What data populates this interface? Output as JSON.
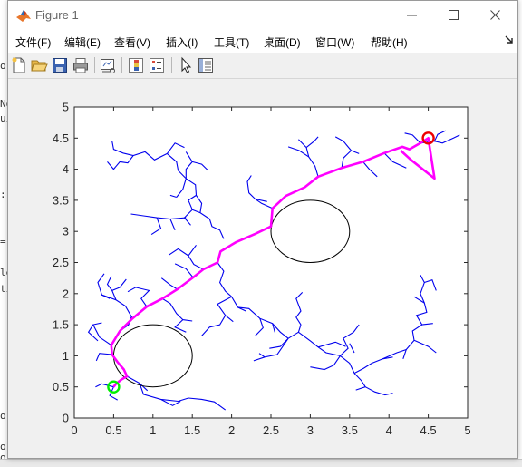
{
  "window": {
    "title": "Figure 1"
  },
  "menu": [
    "文件(F)",
    "编辑(E)",
    "查看(V)",
    "插入(I)",
    "工具(T)",
    "桌面(D)",
    "窗口(W)",
    "帮助(H)"
  ],
  "toolbar": [
    "new-figure",
    "open-file",
    "save-figure",
    "print-figure",
    "link-plot",
    "insert-colorbar",
    "insert-legend",
    "edit-plot",
    "property-inspector"
  ],
  "background_text": [
    "No",
    "ui",
    ":",
    "=",
    "le",
    "ti",
    "o",
    "o:",
    "o(",
    "o)"
  ],
  "chart_data": {
    "type": "line",
    "title": "",
    "xlabel": "",
    "ylabel": "",
    "xlim": [
      0,
      5
    ],
    "ylim": [
      0,
      5
    ],
    "xticks": [
      "0",
      "0.5",
      "1",
      "1.5",
      "2",
      "2.5",
      "3",
      "3.5",
      "4",
      "4.5",
      "5"
    ],
    "yticks": [
      "0",
      "0.5",
      "1",
      "1.5",
      "2",
      "2.5",
      "3",
      "3.5",
      "4",
      "4.5",
      "5"
    ],
    "grid": false,
    "obstacles": [
      {
        "cx": 1.0,
        "cy": 1.0,
        "rx": 0.5,
        "ry": 0.5,
        "color": "#000000"
      },
      {
        "cx": 3.0,
        "cy": 3.0,
        "rx": 0.5,
        "ry": 0.5,
        "color": "#000000"
      }
    ],
    "start": {
      "x": 0.5,
      "y": 0.5,
      "color": "#00ee00"
    },
    "goal": {
      "x": 4.5,
      "y": 4.5,
      "color": "#ee0000"
    },
    "tree_color": "#0000ee",
    "path_color": "#ff00ff",
    "path": [
      [
        0.5,
        0.5
      ],
      [
        0.53,
        0.55
      ],
      [
        0.6,
        0.62
      ],
      [
        0.67,
        0.67
      ],
      [
        0.63,
        0.78
      ],
      [
        0.55,
        0.9
      ],
      [
        0.48,
        1.02
      ],
      [
        0.47,
        1.17
      ],
      [
        0.58,
        1.4
      ],
      [
        0.74,
        1.6
      ],
      [
        0.92,
        1.79
      ],
      [
        1.12,
        1.92
      ],
      [
        1.31,
        2.07
      ],
      [
        1.51,
        2.26
      ],
      [
        1.64,
        2.39
      ],
      [
        1.82,
        2.5
      ],
      [
        1.86,
        2.68
      ],
      [
        2.06,
        2.83
      ],
      [
        2.3,
        2.96
      ],
      [
        2.5,
        3.08
      ],
      [
        2.52,
        3.37
      ],
      [
        2.69,
        3.57
      ],
      [
        2.93,
        3.71
      ],
      [
        3.1,
        3.88
      ],
      [
        3.4,
        4.02
      ],
      [
        3.67,
        4.12
      ],
      [
        3.94,
        4.26
      ],
      [
        4.17,
        4.36
      ],
      [
        4.26,
        4.32
      ],
      [
        4.4,
        4.42
      ],
      [
        4.5,
        4.5
      ],
      [
        4.58,
        3.85
      ],
      [
        4.28,
        4.15
      ],
      [
        4.15,
        4.3
      ]
    ],
    "tree": [
      [
        [
          0.5,
          0.5
        ],
        [
          0.35,
          0.55
        ],
        [
          0.27,
          0.5
        ]
      ],
      [
        [
          0.5,
          0.5
        ],
        [
          0.45,
          0.36
        ],
        [
          0.55,
          0.29
        ]
      ],
      [
        [
          0.67,
          0.67
        ],
        [
          0.83,
          0.56
        ],
        [
          0.88,
          0.38
        ],
        [
          1.1,
          0.3
        ],
        [
          1.32,
          0.27
        ],
        [
          1.45,
          0.32
        ]
      ],
      [
        [
          1.1,
          0.3
        ],
        [
          1.25,
          0.2
        ],
        [
          1.35,
          0.27
        ]
      ],
      [
        [
          1.45,
          0.32
        ],
        [
          1.62,
          0.3
        ],
        [
          1.78,
          0.26
        ],
        [
          1.92,
          0.13
        ]
      ],
      [
        [
          0.83,
          0.56
        ],
        [
          0.93,
          0.44
        ]
      ],
      [
        [
          0.48,
          1.02
        ],
        [
          0.32,
          1.04
        ],
        [
          0.28,
          0.92
        ]
      ],
      [
        [
          0.47,
          1.17
        ],
        [
          0.32,
          1.3
        ],
        [
          0.24,
          1.5
        ],
        [
          0.35,
          1.53
        ]
      ],
      [
        [
          0.24,
          1.5
        ],
        [
          0.18,
          1.38
        ],
        [
          0.3,
          1.24
        ]
      ],
      [
        [
          0.58,
          1.4
        ],
        [
          0.69,
          1.5
        ],
        [
          0.73,
          1.64
        ]
      ],
      [
        [
          0.74,
          1.6
        ],
        [
          0.65,
          1.8
        ],
        [
          0.53,
          1.9
        ],
        [
          0.48,
          2.05
        ],
        [
          0.42,
          2.15
        ],
        [
          0.47,
          2.28
        ]
      ],
      [
        [
          0.48,
          2.05
        ],
        [
          0.58,
          2.1
        ],
        [
          0.66,
          2.23
        ]
      ],
      [
        [
          0.53,
          1.9
        ],
        [
          0.35,
          1.98
        ],
        [
          0.3,
          2.18
        ],
        [
          0.38,
          2.32
        ]
      ],
      [
        [
          0.35,
          1.98
        ],
        [
          0.45,
          1.92
        ]
      ],
      [
        [
          0.92,
          1.79
        ],
        [
          0.85,
          1.92
        ],
        [
          0.95,
          2.05
        ],
        [
          0.78,
          2.1
        ],
        [
          0.68,
          2.03
        ]
      ],
      [
        [
          1.12,
          1.92
        ],
        [
          1.22,
          1.84
        ],
        [
          1.3,
          1.68
        ],
        [
          1.38,
          1.58
        ],
        [
          1.5,
          1.56
        ]
      ],
      [
        [
          1.38,
          1.58
        ],
        [
          1.28,
          1.46
        ],
        [
          1.42,
          1.38
        ]
      ],
      [
        [
          1.31,
          2.07
        ],
        [
          1.22,
          2.14
        ],
        [
          1.11,
          2.25
        ]
      ],
      [
        [
          1.51,
          2.26
        ],
        [
          1.42,
          2.4
        ],
        [
          1.28,
          2.48
        ]
      ],
      [
        [
          1.64,
          2.39
        ],
        [
          1.52,
          2.47
        ],
        [
          1.45,
          2.61
        ],
        [
          1.55,
          2.78
        ]
      ],
      [
        [
          1.45,
          2.61
        ],
        [
          1.32,
          2.72
        ],
        [
          1.2,
          2.62
        ]
      ],
      [
        [
          1.82,
          2.5
        ],
        [
          1.9,
          2.36
        ],
        [
          1.85,
          2.18
        ],
        [
          1.92,
          2.04
        ],
        [
          2.0,
          1.95
        ],
        [
          2.08,
          1.78
        ],
        [
          2.18,
          1.72
        ]
      ],
      [
        [
          2.0,
          1.95
        ],
        [
          1.82,
          1.83
        ],
        [
          1.92,
          1.65
        ],
        [
          1.85,
          1.5
        ],
        [
          1.72,
          1.46
        ],
        [
          1.62,
          1.32
        ]
      ],
      [
        [
          1.92,
          1.65
        ],
        [
          2.02,
          1.55
        ]
      ],
      [
        [
          2.08,
          1.78
        ],
        [
          2.22,
          1.76
        ],
        [
          2.36,
          1.6
        ],
        [
          2.52,
          1.52
        ],
        [
          2.62,
          1.38
        ],
        [
          2.72,
          1.28
        ]
      ],
      [
        [
          2.36,
          1.6
        ],
        [
          2.4,
          1.45
        ],
        [
          2.3,
          1.32
        ]
      ],
      [
        [
          2.52,
          1.52
        ],
        [
          2.55,
          1.38
        ]
      ],
      [
        [
          2.72,
          1.28
        ],
        [
          2.85,
          1.38
        ],
        [
          2.88,
          1.5
        ],
        [
          2.82,
          1.62
        ],
        [
          2.88,
          1.72
        ],
        [
          2.82,
          1.92
        ],
        [
          2.9,
          2.02
        ]
      ],
      [
        [
          2.85,
          1.38
        ],
        [
          3.0,
          1.24
        ],
        [
          3.1,
          1.14
        ]
      ],
      [
        [
          2.72,
          1.28
        ],
        [
          2.62,
          1.15
        ],
        [
          2.48,
          1.12
        ]
      ],
      [
        [
          2.72,
          1.28
        ],
        [
          2.58,
          1.02
        ],
        [
          2.42,
          0.98
        ],
        [
          2.35,
          1.04
        ]
      ],
      [
        [
          2.42,
          0.98
        ],
        [
          2.28,
          0.92
        ]
      ],
      [
        [
          3.1,
          1.14
        ],
        [
          3.2,
          1.05
        ],
        [
          3.38,
          1.0
        ],
        [
          3.5,
          0.88
        ],
        [
          3.56,
          0.72
        ]
      ],
      [
        [
          3.38,
          1.0
        ],
        [
          3.3,
          0.85
        ],
        [
          3.18,
          0.78
        ],
        [
          3.0,
          0.82
        ]
      ],
      [
        [
          3.1,
          1.14
        ],
        [
          3.32,
          1.22
        ],
        [
          3.45,
          1.15
        ]
      ],
      [
        [
          3.38,
          1.0
        ],
        [
          3.48,
          1.12
        ],
        [
          3.42,
          1.28
        ],
        [
          3.55,
          1.38
        ],
        [
          3.62,
          1.5
        ]
      ],
      [
        [
          3.56,
          0.72
        ],
        [
          3.65,
          0.6
        ],
        [
          3.7,
          0.5
        ],
        [
          3.58,
          0.45
        ]
      ],
      [
        [
          3.7,
          0.5
        ],
        [
          3.82,
          0.42
        ],
        [
          3.95,
          0.37
        ],
        [
          4.05,
          0.4
        ]
      ],
      [
        [
          3.56,
          0.72
        ],
        [
          3.68,
          0.8
        ],
        [
          3.78,
          0.88
        ],
        [
          3.92,
          0.95
        ],
        [
          4.05,
          0.98
        ]
      ],
      [
        [
          3.92,
          0.95
        ],
        [
          4.1,
          1.05
        ],
        [
          4.22,
          1.1
        ],
        [
          4.32,
          1.25
        ],
        [
          4.3,
          1.4
        ],
        [
          4.42,
          1.5
        ],
        [
          4.35,
          1.65
        ],
        [
          4.48,
          1.7
        ],
        [
          4.45,
          1.85
        ],
        [
          4.4,
          2.0
        ],
        [
          4.45,
          2.18
        ],
        [
          4.4,
          2.3
        ]
      ],
      [
        [
          4.32,
          1.25
        ],
        [
          4.5,
          1.15
        ],
        [
          4.6,
          1.05
        ]
      ],
      [
        [
          4.42,
          1.5
        ],
        [
          4.56,
          1.52
        ]
      ],
      [
        [
          4.45,
          1.85
        ],
        [
          4.32,
          1.95
        ]
      ],
      [
        [
          4.45,
          2.18
        ],
        [
          4.55,
          2.22
        ],
        [
          4.6,
          2.05
        ]
      ],
      [
        [
          4.22,
          1.1
        ],
        [
          4.18,
          0.95
        ]
      ],
      [
        [
          3.5,
          1.2
        ],
        [
          3.56,
          1.05
        ]
      ],
      [
        [
          1.18,
          4.25
        ],
        [
          1.02,
          4.15
        ],
        [
          0.9,
          4.28
        ],
        [
          0.75,
          4.22
        ],
        [
          0.62,
          4.26
        ],
        [
          0.5,
          4.32
        ],
        [
          0.48,
          4.45
        ]
      ],
      [
        [
          0.75,
          4.22
        ],
        [
          0.68,
          4.1
        ],
        [
          0.58,
          4.12
        ],
        [
          0.5,
          4.0
        ],
        [
          0.42,
          4.12
        ]
      ],
      [
        [
          1.18,
          4.25
        ],
        [
          1.28,
          4.42
        ],
        [
          1.4,
          4.35
        ]
      ],
      [
        [
          1.18,
          4.25
        ],
        [
          1.3,
          4.12
        ],
        [
          1.32,
          3.98
        ],
        [
          1.42,
          3.85
        ],
        [
          1.38,
          3.68
        ],
        [
          1.3,
          3.55
        ]
      ],
      [
        [
          1.42,
          3.85
        ],
        [
          1.54,
          3.75
        ],
        [
          1.55,
          3.58
        ],
        [
          1.45,
          3.5
        ],
        [
          1.5,
          3.35
        ],
        [
          1.4,
          3.22
        ],
        [
          1.48,
          3.1
        ]
      ],
      [
        [
          1.55,
          3.58
        ],
        [
          1.62,
          3.45
        ],
        [
          1.6,
          3.3
        ],
        [
          1.72,
          3.2
        ],
        [
          1.75,
          3.08
        ],
        [
          1.85,
          3.02
        ],
        [
          1.9,
          2.88
        ]
      ],
      [
        [
          1.6,
          3.3
        ],
        [
          1.5,
          3.35
        ]
      ],
      [
        [
          1.42,
          3.85
        ],
        [
          1.42,
          4.0
        ],
        [
          1.5,
          4.12
        ],
        [
          1.42,
          4.28
        ]
      ],
      [
        [
          1.5,
          4.12
        ],
        [
          1.62,
          4.08
        ],
        [
          1.7,
          3.98
        ]
      ],
      [
        [
          1.42,
          3.22
        ],
        [
          1.22,
          3.2
        ],
        [
          1.05,
          3.22
        ],
        [
          0.88,
          3.25
        ],
        [
          0.72,
          3.28
        ]
      ],
      [
        [
          1.05,
          3.22
        ],
        [
          1.1,
          3.05
        ],
        [
          0.98,
          2.95
        ]
      ],
      [
        [
          1.22,
          3.2
        ],
        [
          1.28,
          3.02
        ]
      ],
      [
        [
          1.22,
          3.58
        ],
        [
          1.3,
          3.55
        ]
      ],
      [
        [
          2.52,
          3.37
        ],
        [
          2.38,
          3.45
        ],
        [
          2.3,
          3.52
        ],
        [
          2.22,
          3.62
        ],
        [
          2.2,
          3.8
        ],
        [
          2.25,
          3.9
        ]
      ],
      [
        [
          2.3,
          3.52
        ],
        [
          2.45,
          3.48
        ]
      ],
      [
        [
          3.1,
          3.88
        ],
        [
          3.06,
          4.05
        ],
        [
          2.98,
          4.2
        ],
        [
          2.95,
          4.35
        ],
        [
          3.05,
          4.45
        ],
        [
          3.1,
          4.52
        ]
      ],
      [
        [
          2.98,
          4.2
        ],
        [
          2.86,
          4.3
        ],
        [
          2.72,
          4.36
        ]
      ],
      [
        [
          2.95,
          4.35
        ],
        [
          2.85,
          4.48
        ]
      ],
      [
        [
          3.4,
          4.02
        ],
        [
          3.42,
          4.18
        ],
        [
          3.52,
          4.3
        ],
        [
          3.42,
          4.45
        ],
        [
          3.32,
          4.52
        ]
      ],
      [
        [
          3.52,
          4.3
        ],
        [
          3.62,
          4.25
        ]
      ],
      [
        [
          3.67,
          4.12
        ],
        [
          3.75,
          4.0
        ],
        [
          3.85,
          3.88
        ]
      ],
      [
        [
          3.94,
          4.26
        ],
        [
          4.05,
          4.12
        ],
        [
          4.22,
          4.02
        ]
      ],
      [
        [
          4.4,
          4.42
        ],
        [
          4.58,
          4.45
        ],
        [
          4.68,
          4.42
        ],
        [
          4.82,
          4.5
        ],
        [
          4.9,
          4.55
        ]
      ],
      [
        [
          4.58,
          4.45
        ],
        [
          4.62,
          4.56
        ],
        [
          4.72,
          4.62
        ]
      ],
      [
        [
          4.4,
          4.42
        ],
        [
          4.3,
          4.55
        ],
        [
          4.2,
          4.58
        ]
      ]
    ]
  }
}
